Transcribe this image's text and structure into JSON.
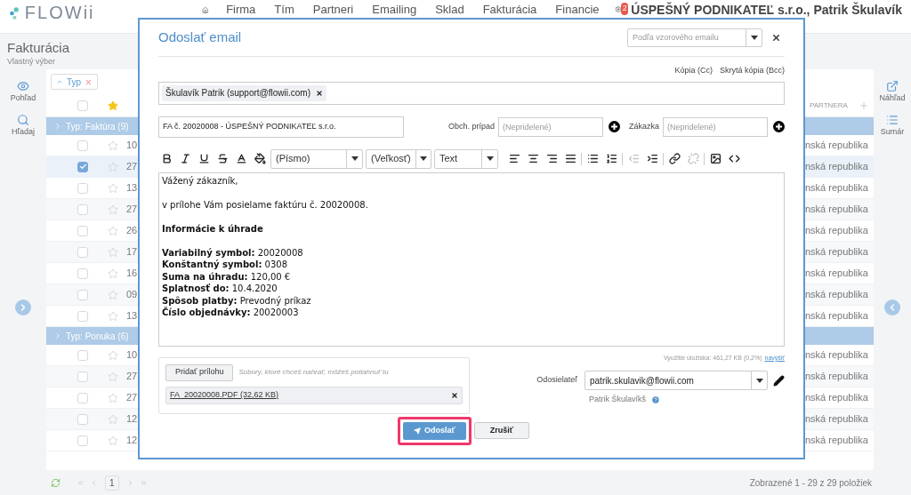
{
  "app": {
    "logo": "FLOWii",
    "nav": [
      "Firma",
      "Tím",
      "Partneri",
      "Emailing",
      "Sklad",
      "Fakturácia",
      "Financie"
    ],
    "notifications": "2",
    "account": "ÚSPEŠNÝ PODNIKATEĽ s.r.o., Patrik Škulavík"
  },
  "page": {
    "title": "Fakturácia",
    "subtitle": "Vlastný výber"
  },
  "left_tools": [
    "Pohľad",
    "Hľadaj"
  ],
  "right_tools": [
    "Náhľad",
    "Sumár"
  ],
  "filter_chip": "Typ",
  "table": {
    "all_checked": false,
    "column_partner": "PARTNERA",
    "groups": [
      {
        "label": "Typ: Faktúra (9)",
        "rows": [
          {
            "number": "10",
            "checked": false,
            "country": "nská republika"
          },
          {
            "number": "27",
            "checked": true,
            "country": "nská republika"
          },
          {
            "number": "13",
            "checked": false,
            "country": "nská republika"
          },
          {
            "number": "27",
            "checked": false,
            "country": "nská republika"
          },
          {
            "number": "26",
            "checked": false,
            "country": "nská republika"
          },
          {
            "number": "17",
            "checked": false,
            "country": "nská republika"
          },
          {
            "number": "16",
            "checked": false,
            "country": "nská republika"
          },
          {
            "number": "09",
            "checked": false,
            "country": "nská republika"
          },
          {
            "number": "13",
            "checked": false,
            "country": "nská republika"
          }
        ]
      },
      {
        "label": "Typ: Ponuka (6)",
        "rows": [
          {
            "number": "10",
            "checked": false,
            "country": "nská republika"
          },
          {
            "number": "27",
            "checked": false,
            "country": "nská republika"
          },
          {
            "number": "27",
            "checked": false,
            "country": "nská republika"
          },
          {
            "number": "12",
            "checked": false,
            "country": "nská republika"
          },
          {
            "number": "12",
            "checked": false,
            "country": "nská republika"
          }
        ]
      }
    ]
  },
  "pager": {
    "page": "1",
    "summary": "Zobrazené 1 - 29 z 29 položiek"
  },
  "dialog": {
    "title": "Odoslať email",
    "template_placeholder": "Podľa vzorového emailu",
    "cc": "Kópia (Cc)",
    "bcc": "Skrytá kópia (Bcc)",
    "recipients": [
      "Škulavík Patrik (support@flowii.com)"
    ],
    "subject": "FA č. 20020008 - ÚSPEŠNÝ PODNIKATEĽ s.r.o.",
    "links": [
      {
        "label": "Obch. prípad",
        "placeholder": "(Nepridelené)"
      },
      {
        "label": "Zákazka",
        "placeholder": "(Nepridelené)"
      }
    ],
    "toolbar_selects": [
      "(Písmo)",
      "(Veľkosť)",
      "Text"
    ],
    "toolbar_buttons": [
      {
        "disabled": false
      },
      {
        "disabled": false
      },
      {
        "disabled": false
      },
      {
        "disabled": false
      },
      {
        "disabled": false
      },
      {
        "disabled": false
      },
      {
        "disabled": false
      },
      {
        "disabled": false
      },
      {
        "disabled": false
      },
      {
        "disabled": false
      },
      {
        "disabled": false
      },
      {
        "disabled": false
      },
      {
        "disabled": true
      },
      {
        "disabled": false
      },
      {
        "disabled": false
      },
      {
        "disabled": true
      },
      {
        "disabled": false
      },
      {
        "disabled": false
      }
    ],
    "body": [
      [
        "Vážený zákazník,"
      ],
      [
        "v prílohe Vám posielame faktúru č. 20020008."
      ],
      [
        "**Informácie k úhrade**"
      ],
      [
        "**Variabilný symbol:** 20020008",
        "**Konštantný symbol:** 0308",
        "**Suma na úhradu:** 120,00 €",
        "**Splatnosť do:** 10.4.2020",
        "**Spôsob platby:** Prevodný príkaz",
        "**Číslo objednávky:** 20020003"
      ]
    ],
    "add_attachment": "Pridať prílohu",
    "drop_hint": "Súbory, ktoré chceš nahrať, môžeš potiahnuť tu",
    "attachments": [
      "FA_20020008.PDF (32,62 KB)"
    ],
    "storage": "Využitie úložiska: 461,27 KB (0,2%)",
    "storage_link": "navýšiť",
    "sender_label": "Odosielateľ",
    "sender": "patrik.skulavik@flowii.com",
    "sender_name": "Patrik Škulavíkš",
    "send": "Odoslať",
    "cancel": "Zrušiť"
  }
}
